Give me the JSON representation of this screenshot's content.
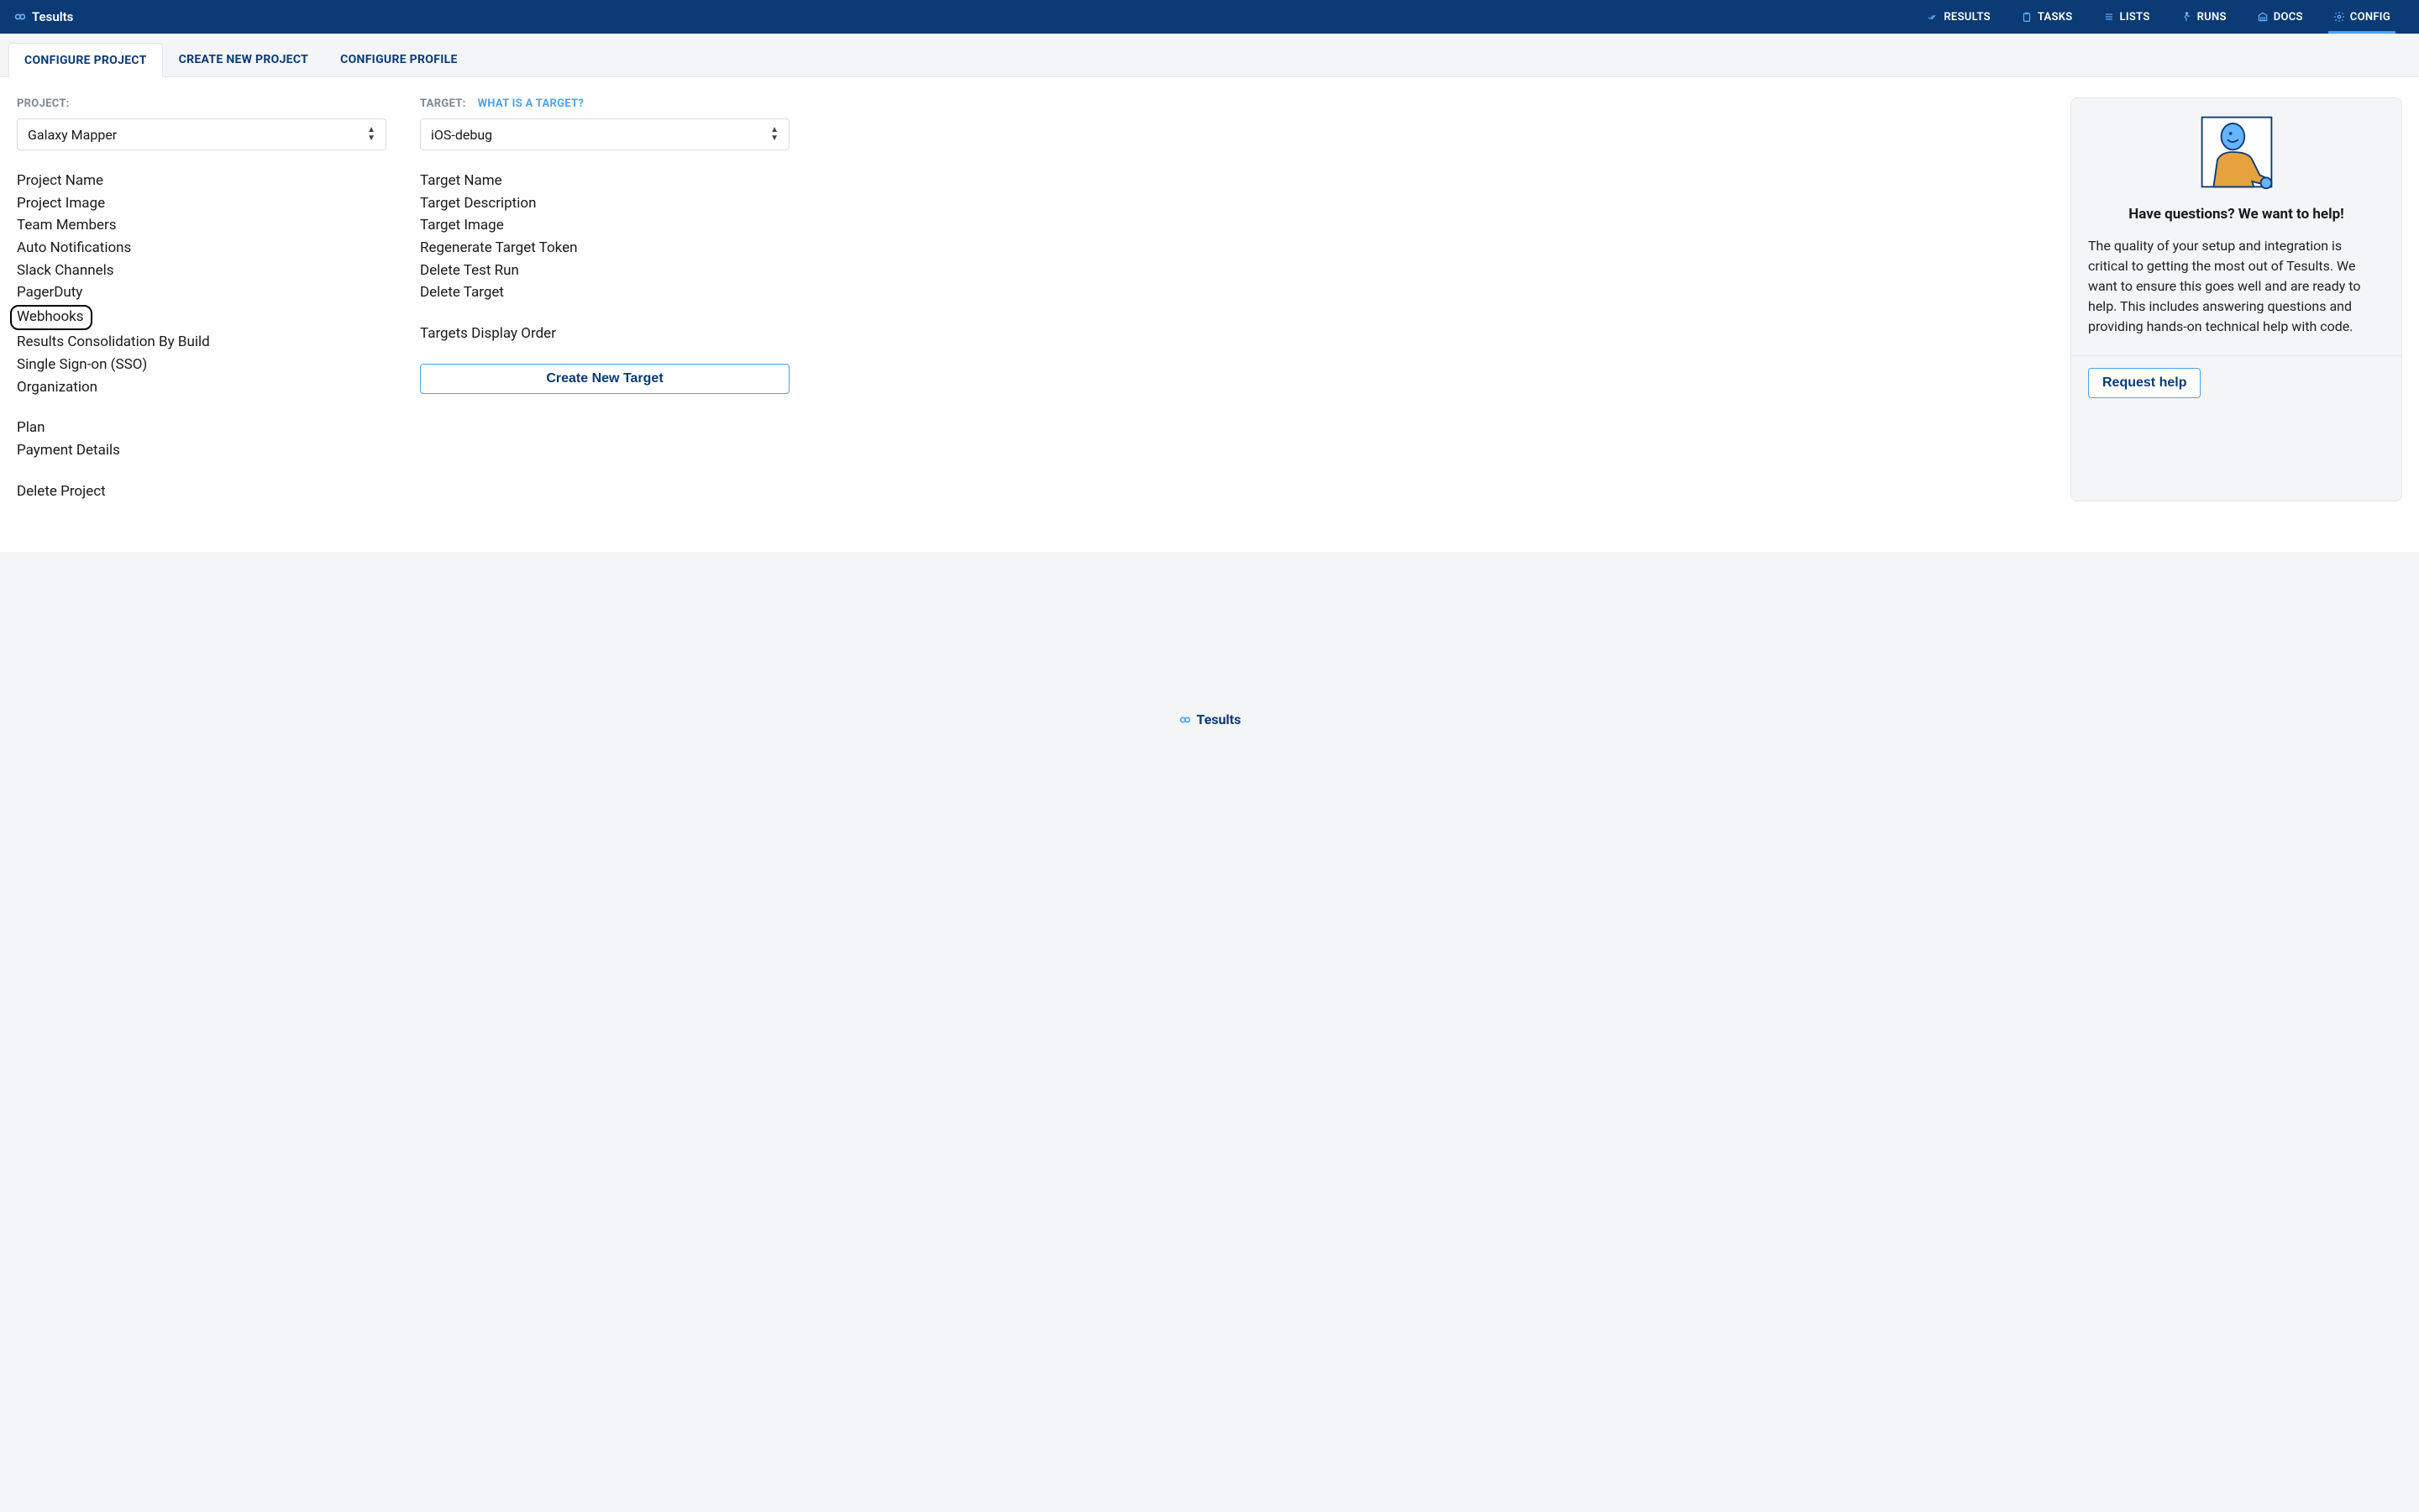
{
  "brand": "Tesults",
  "topnav": {
    "results": "RESULTS",
    "tasks": "TASKS",
    "lists": "LISTS",
    "runs": "RUNS",
    "docs": "DOCS",
    "config": "CONFIG"
  },
  "tabs": {
    "configure_project": "CONFIGURE PROJECT",
    "create_new_project": "CREATE NEW PROJECT",
    "configure_profile": "CONFIGURE PROFILE"
  },
  "project": {
    "label": "PROJECT:",
    "selected": "Galaxy Mapper",
    "links": {
      "project_name": "Project Name",
      "project_image": "Project Image",
      "team_members": "Team Members",
      "auto_notifications": "Auto Notifications",
      "slack_channels": "Slack Channels",
      "pagerduty": "PagerDuty",
      "webhooks": "Webhooks",
      "results_consolidation": "Results Consolidation By Build",
      "sso": "Single Sign-on (SSO)",
      "organization": "Organization",
      "plan": "Plan",
      "payment_details": "Payment Details",
      "delete_project": "Delete Project"
    }
  },
  "target": {
    "label": "TARGET:",
    "hint": "WHAT IS A TARGET?",
    "selected": "iOS-debug",
    "links": {
      "target_name": "Target Name",
      "target_description": "Target Description",
      "target_image": "Target Image",
      "regenerate_token": "Regenerate Target Token",
      "delete_test_run": "Delete Test Run",
      "delete_target": "Delete Target",
      "display_order": "Targets Display Order"
    },
    "create_button": "Create New Target"
  },
  "help": {
    "title": "Have questions? We want to help!",
    "body": "The quality of your setup and integration is critical to getting the most out of Tesults. We want to ensure this goes well and are ready to help. This includes answering questions and providing hands-on technical help with code.",
    "button": "Request help"
  },
  "footer_brand": "Tesults"
}
